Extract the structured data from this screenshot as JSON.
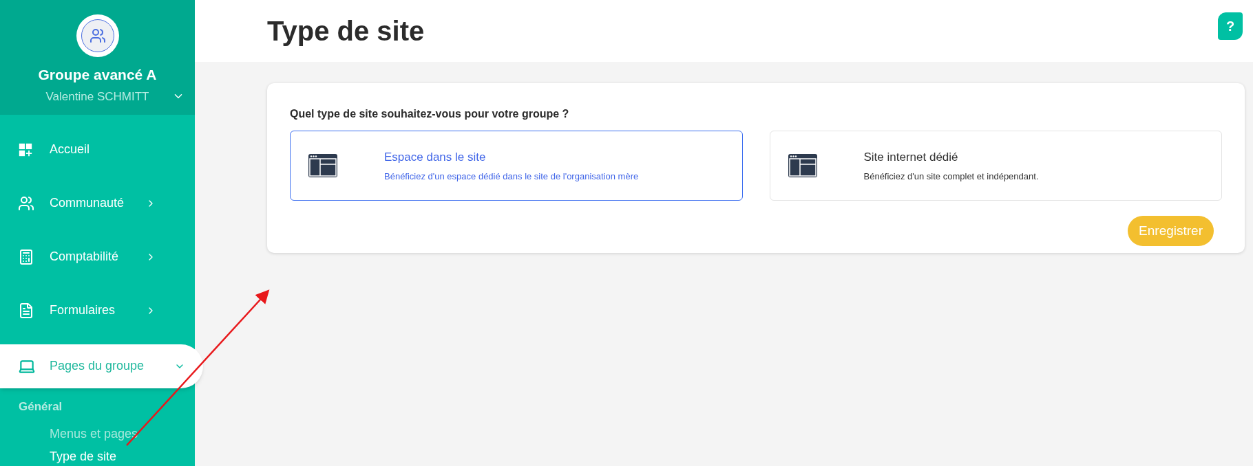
{
  "sidebar": {
    "group_name": "Groupe avancé A",
    "user_name": "Valentine SCHMITT",
    "items": [
      {
        "label": "Accueil",
        "selected": false
      },
      {
        "label": "Communauté",
        "selected": false,
        "expanded": false
      },
      {
        "label": "Comptabilité",
        "selected": false,
        "expanded": false
      },
      {
        "label": "Formulaires",
        "selected": false,
        "expanded": false
      },
      {
        "label": "Pages du groupe",
        "selected": true,
        "expanded": true
      }
    ],
    "submenu": {
      "heading": "Général",
      "items": [
        {
          "label": "Menus et pages",
          "selected": false
        },
        {
          "label": "Type de site",
          "selected": true
        }
      ]
    }
  },
  "page": {
    "title": "Type de site",
    "help": "?"
  },
  "card": {
    "question": "Quel type de site souhaitez-vous pour votre groupe ?",
    "options": [
      {
        "title": "Espace dans le site",
        "description": "Bénéficiez d'un espace dédié dans le site de l'organisation mère",
        "selected": true
      },
      {
        "title": "Site internet dédié",
        "description": "Bénéficiez d'un site complet et indépendant.",
        "selected": false
      }
    ],
    "save_button": "Enregistrer"
  }
}
